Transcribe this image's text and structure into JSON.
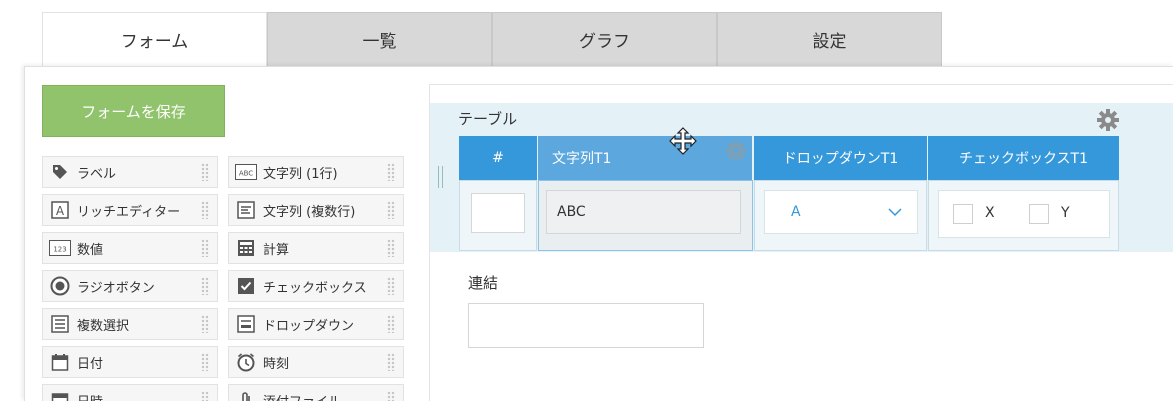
{
  "tabs": [
    {
      "label": "フォーム",
      "active": true
    },
    {
      "label": "一覧",
      "active": false
    },
    {
      "label": "グラフ",
      "active": false
    },
    {
      "label": "設定",
      "active": false
    }
  ],
  "save_button": "フォームを保存",
  "palette": [
    {
      "label": "ラベル",
      "icon": "tag-icon"
    },
    {
      "label": "文字列 (1行)",
      "icon": "abc-text-icon"
    },
    {
      "label": "リッチエディター",
      "icon": "rich-editor-icon"
    },
    {
      "label": "文字列 (複数行)",
      "icon": "multiline-text-icon"
    },
    {
      "label": "数値",
      "icon": "number-icon"
    },
    {
      "label": "計算",
      "icon": "calculator-icon"
    },
    {
      "label": "ラジオボタン",
      "icon": "radio-icon"
    },
    {
      "label": "チェックボックス",
      "icon": "checkbox-icon"
    },
    {
      "label": "複数選択",
      "icon": "multi-select-icon"
    },
    {
      "label": "ドロップダウン",
      "icon": "dropdown-icon"
    },
    {
      "label": "日付",
      "icon": "calendar-icon"
    },
    {
      "label": "時刻",
      "icon": "clock-icon"
    },
    {
      "label": "日時",
      "icon": "datetime-icon"
    },
    {
      "label": "添付ファイル",
      "icon": "attachment-icon"
    }
  ],
  "table": {
    "title": "テーブル",
    "headers": {
      "num": "#",
      "str": "文字列T1",
      "dropdown": "ドロップダウンT1",
      "checkbox": "チェックボックスT1"
    },
    "str_value": "ABC",
    "dropdown_value": "A",
    "checkbox_options": [
      "X",
      "Y"
    ]
  },
  "link_field": {
    "label": "連結"
  },
  "colors": {
    "header_blue": "#3498db",
    "selected_header": "#5ba7de",
    "save_green": "#91c36c",
    "table_bg": "#e4f2f8"
  }
}
